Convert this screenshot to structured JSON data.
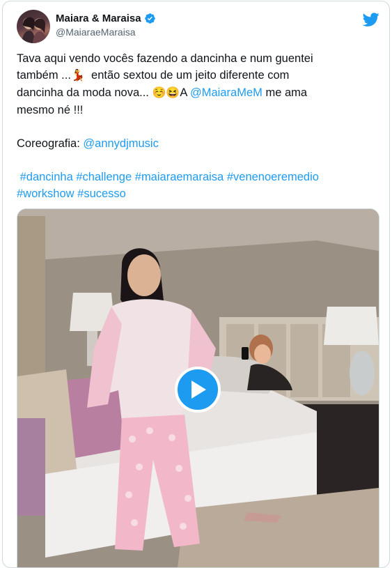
{
  "tweet": {
    "author": {
      "display_name": "Maiara & Maraisa",
      "handle": "@MaiaraeMaraisa",
      "verified": true
    },
    "text": {
      "line1": "Tava aqui vendo vocês fazendo a dancinha e num guentei",
      "line2_a": "também ...",
      "emoji_dancer": "💃",
      "line2_b": "  então sextou de um jeito diferente com",
      "line3_a": "dancinha da moda nova... ",
      "emoji_smile": "☺️",
      "emoji_laugh": "😆",
      "line3_b": "A ",
      "mention_1": "@MaiaraMeM",
      "line3_c": " me ama",
      "line4": "mesmo né !!!",
      "credit_label": "Coreografia: ",
      "mention_2": "@annydjmusic",
      "hashtags_line1": [
        " #dancinha",
        "#challenge",
        "#maiaraemaraisa",
        "#venenoeremedio"
      ],
      "hashtags_line2": [
        "#workshow",
        "#sucesso"
      ]
    },
    "media": {
      "type": "video",
      "play_icon": "play-icon"
    },
    "icons": {
      "brand": "twitter-bird-icon",
      "verified": "verified-badge-icon"
    },
    "colors": {
      "accent": "#1d9bf0",
      "text": "#0f1419",
      "secondary": "#536471"
    }
  }
}
